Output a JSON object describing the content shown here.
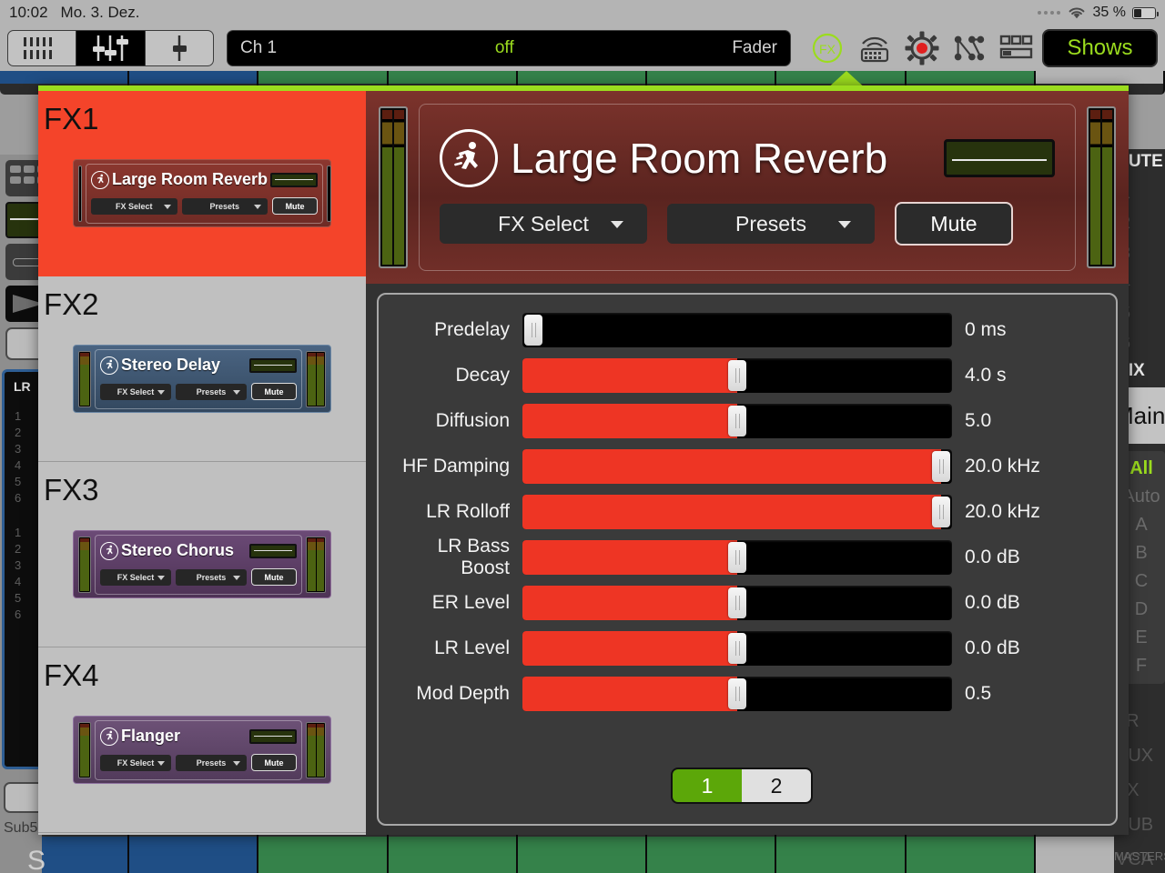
{
  "statusbar": {
    "time": "10:02",
    "date": "Mo. 3. Dez.",
    "battery_pct": "35 %"
  },
  "toolbar": {
    "segments": [
      {
        "icon": "eq-bars-icon",
        "active": false
      },
      {
        "icon": "faders-icon",
        "active": true
      },
      {
        "icon": "single-fader-icon",
        "active": false
      }
    ],
    "channel_field": {
      "channel": "Ch 1",
      "status": "off",
      "mode": "Fader"
    },
    "icons": [
      "fx-icon",
      "wireless-remote-icon",
      "gear-record-icon",
      "routing-icon",
      "layout-icon"
    ],
    "shows_label": "Shows"
  },
  "fx_list": [
    {
      "slot": "FX1",
      "name": "Large Room Reverb",
      "theme": "reverb",
      "selected": true,
      "fx_select": "FX Select",
      "presets": "Presets",
      "mute": "Mute"
    },
    {
      "slot": "FX2",
      "name": "Stereo Delay",
      "theme": "delay",
      "selected": false,
      "fx_select": "FX Select",
      "presets": "Presets",
      "mute": "Mute"
    },
    {
      "slot": "FX3",
      "name": "Stereo Chorus",
      "theme": "chorus",
      "selected": false,
      "fx_select": "FX Select",
      "presets": "Presets",
      "mute": "Mute"
    },
    {
      "slot": "FX4",
      "name": "Flanger",
      "theme": "flanger",
      "selected": false,
      "fx_select": "FX Select",
      "presets": "Presets",
      "mute": "Mute"
    }
  ],
  "detail": {
    "title": "Large Room Reverb",
    "fx_select": "FX Select",
    "presets": "Presets",
    "mute": "Mute",
    "parameters": [
      {
        "label": "Predelay",
        "value": "0 ms",
        "pct": 0
      },
      {
        "label": "Decay",
        "value": "4.0 s",
        "pct": 50
      },
      {
        "label": "Diffusion",
        "value": "5.0",
        "pct": 50
      },
      {
        "label": "HF Damping",
        "value": "20.0 kHz",
        "pct": 100
      },
      {
        "label": "LR Rolloff",
        "value": "20.0 kHz",
        "pct": 100
      },
      {
        "label": "LR Bass Boost",
        "value": "0.0 dB",
        "pct": 50
      },
      {
        "label": "ER Level",
        "value": "0.0 dB",
        "pct": 50
      },
      {
        "label": "LR Level",
        "value": "0.0 dB",
        "pct": 50
      },
      {
        "label": "Mod Depth",
        "value": "0.5",
        "pct": 50
      }
    ],
    "pages": [
      {
        "label": "1",
        "active": true
      },
      {
        "label": "2",
        "active": false
      }
    ]
  },
  "background": {
    "left_strip": {
      "lr_label": "LR",
      "numbers": [
        "1",
        "2",
        "3",
        "4",
        "5",
        "6"
      ],
      "sub_label": "Sub5",
      "s_label": "S"
    },
    "right_strip": {
      "mute_label": "MUTE",
      "numbers": [
        "1",
        "2",
        "3",
        "4",
        "5",
        "6"
      ],
      "mix_label": "MIX",
      "main_label": "Main",
      "groups": [
        {
          "label": "All",
          "active": true
        },
        {
          "label": "Auto",
          "active": false
        },
        {
          "label": "A",
          "active": false
        },
        {
          "label": "B",
          "active": false
        },
        {
          "label": "C",
          "active": false
        },
        {
          "label": "D",
          "active": false
        },
        {
          "label": "E",
          "active": false
        },
        {
          "label": "F",
          "active": false
        }
      ],
      "tags": [
        "LR",
        "AUX",
        "FX",
        "SUB",
        "VCA"
      ],
      "masters_label": "MASTERS"
    },
    "channel_colors": [
      "#1f4e85",
      "#1f4e85",
      "#35824a",
      "#35824a",
      "#35824a",
      "#35824a",
      "#35824a",
      "#35824a",
      "#b4b4b4"
    ]
  },
  "colors": {
    "accent_green": "#9bdc1e",
    "selected_red": "#f4442a",
    "slider_red": "#ee3524",
    "page_green": "#5ca709"
  }
}
